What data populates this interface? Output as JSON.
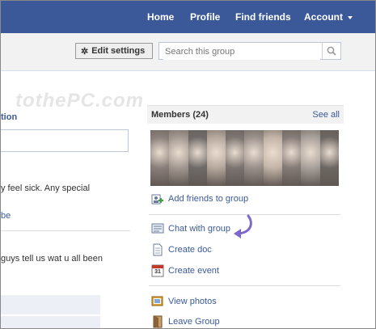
{
  "topnav": {
    "home": "Home",
    "profile": "Profile",
    "find_friends": "Find friends",
    "account": "Account"
  },
  "header": {
    "edit_settings": "Edit settings",
    "search_placeholder": "Search this group"
  },
  "watermark": "tothePC.com",
  "left": {
    "heading_fragment": "tion",
    "post1_fragment": "y feel sick. Any special",
    "link_fragment": "be",
    "post2_fragment": "guys tell us wat u all been"
  },
  "members": {
    "title": "Members (24)",
    "see_all": "See all",
    "photo_colors": [
      "#8a7f7a",
      "#a39890",
      "#6f6a68",
      "#b6a89c",
      "#7c7470",
      "#9a908a",
      "#c2b4a6",
      "#857b76",
      "#a8a09a",
      "#6d6762"
    ]
  },
  "actions": {
    "add_friends": "Add friends to group",
    "chat": "Chat with group",
    "create_doc": "Create doc",
    "create_event": "Create event",
    "calendar_day": "31",
    "view_photos": "View photos",
    "leave_group": "Leave Group"
  },
  "colors": {
    "brand": "#3b5998",
    "annotation_arrow": "#7b68c8"
  }
}
